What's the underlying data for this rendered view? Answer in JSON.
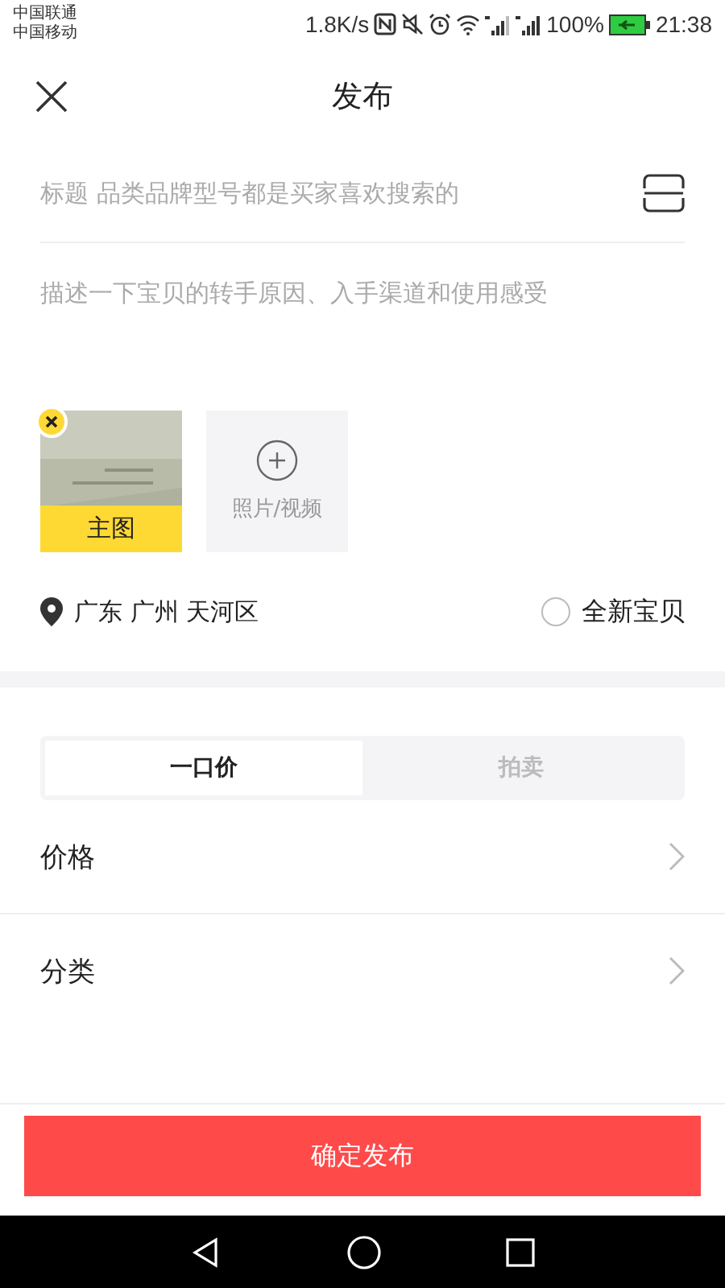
{
  "status_bar": {
    "carriers": [
      "中国联通",
      "中国移动"
    ],
    "speed": "1.8K/s",
    "battery_text": "100%",
    "time": "21:38"
  },
  "header": {
    "title": "发布"
  },
  "title_field": {
    "placeholder": "标题 品类品牌型号都是买家喜欢搜索的"
  },
  "description_field": {
    "placeholder": "描述一下宝贝的转手原因、入手渠道和使用感受"
  },
  "media": {
    "items": [
      {
        "kind": "picture",
        "tag": "主图"
      }
    ],
    "add_label": "照片/视频"
  },
  "location": "广东 广州 天河区",
  "brand_new": {
    "label": "全新宝贝",
    "checked": false
  },
  "sale_tabs": [
    {
      "label": "一口价",
      "selected": true
    },
    {
      "label": "拍卖",
      "selected": false
    }
  ],
  "rows": [
    {
      "label": "价格"
    },
    {
      "label": "分类"
    }
  ],
  "publish_button": "确定发布"
}
